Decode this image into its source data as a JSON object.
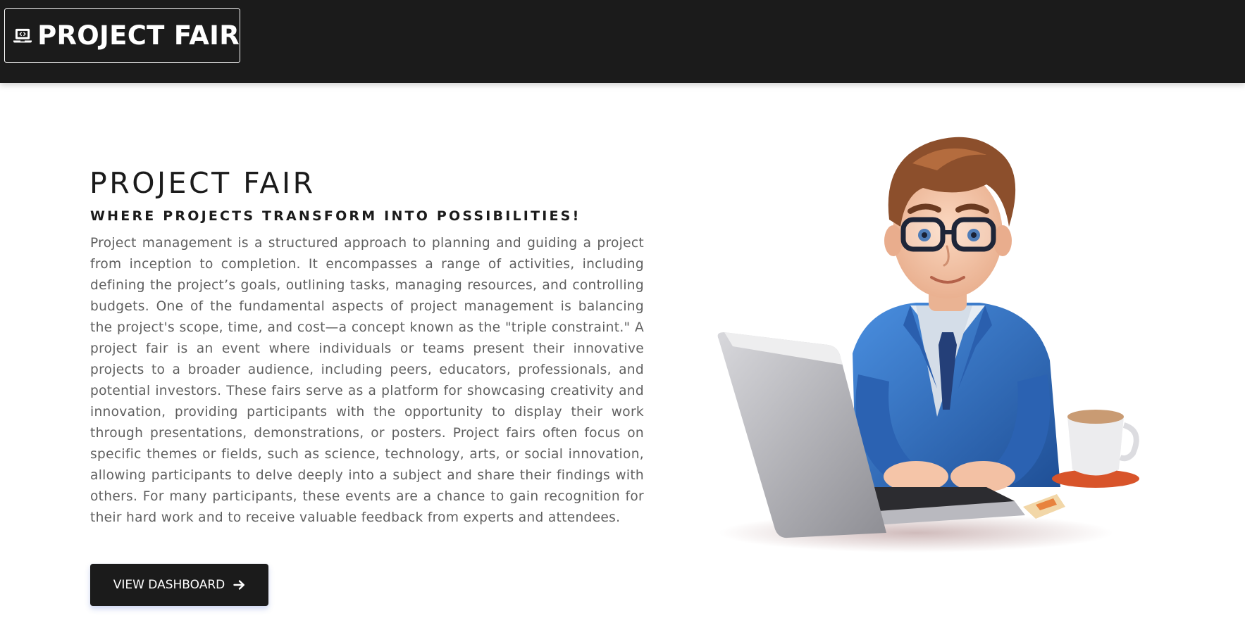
{
  "navbar": {
    "brand_label": "PROJECT FAIR",
    "brand_icon": "laptop-code-icon"
  },
  "hero": {
    "title": "PROJECT FAIR",
    "subtitle": "WHERE PROJECTS TRANSFORM INTO POSSIBILITIES!",
    "body": "Project management is a structured approach to planning and guiding a project from inception to completion. It encompasses a range of activities, including defining the project’s goals, outlining tasks, managing resources, and controlling budgets. One of the fundamental aspects of project management is balancing the project's scope, time, and cost—a concept known as the \"triple constraint.\" A project fair is an event where individuals or teams present their innovative projects to a broader audience, including peers, educators, professionals, and potential investors. These fairs serve as a platform for showcasing creativity and innovation, providing participants with the opportunity to display their work through presentations, demonstrations, or posters. Project fairs often focus on specific themes or fields, such as science, technology, arts, or social innovation, allowing participants to delve deeply into a subject and share their findings with others. For many participants, these events are a chance to gain recognition for their hard work and to receive valuable feedback from experts and attendees.",
    "cta_label": "VIEW DASHBOARD",
    "cta_icon": "arrow-right-icon",
    "illustration": "developer-at-laptop-illustration"
  },
  "colors": {
    "navbar_bg": "#1b1b1b",
    "text_dark": "#1b1b1b",
    "text_body": "#5f5f5f",
    "button_bg": "#1b1b1b",
    "suit_blue": "#2f6fc0"
  }
}
